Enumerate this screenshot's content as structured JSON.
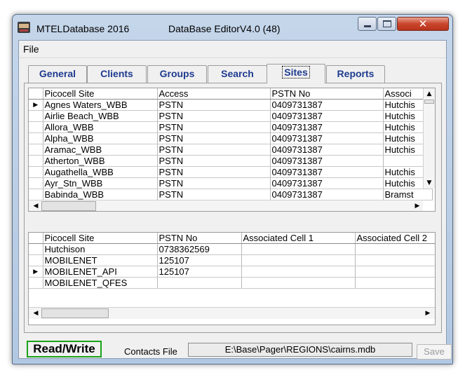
{
  "window": {
    "app_title": "MTELDatabase 2016",
    "editor_title": "DataBase EditorV4.0 (48)"
  },
  "menu": {
    "file": "File"
  },
  "tabs": [
    "General",
    "Clients",
    "Groups",
    "Search",
    "Sites",
    "Reports"
  ],
  "active_tab": "Sites",
  "sites_grid": {
    "columns": [
      "Picocell Site",
      "Access",
      "PSTN No",
      "Associ"
    ],
    "rows": [
      [
        "Agnes Waters_WBB",
        "PSTN",
        "0409731387",
        "Hutchis"
      ],
      [
        "Airlie Beach_WBB",
        "PSTN",
        "0409731387",
        "Hutchis"
      ],
      [
        "Allora_WBB",
        "PSTN",
        "0409731387",
        "Hutchis"
      ],
      [
        "Alpha_WBB",
        "PSTN",
        "0409731387",
        "Hutchis"
      ],
      [
        "Aramac_WBB",
        "PSTN",
        "0409731387",
        "Hutchis"
      ],
      [
        "Atherton_WBB",
        "PSTN",
        "0409731387",
        ""
      ],
      [
        "Augathella_WBB",
        "PSTN",
        "0409731387",
        "Hutchis"
      ],
      [
        "Ayr_Stn_WBB",
        "PSTN",
        "0409731387",
        "Hutchis"
      ],
      [
        "Babinda_WBB",
        "PSTN",
        "0409731387",
        "Bramst"
      ]
    ],
    "current_row": 0
  },
  "clients_grid": {
    "columns": [
      "Picocell Site",
      "PSTN No",
      "Associated Cell 1",
      "Associated Cell 2"
    ],
    "rows": [
      [
        "Hutchison",
        "0738362569",
        "",
        ""
      ],
      [
        "MOBILENET",
        "125107",
        "",
        ""
      ],
      [
        "MOBILENET_API",
        "125107",
        "",
        ""
      ],
      [
        "MOBILENET_QFES",
        "",
        "",
        ""
      ]
    ],
    "current_row": 2
  },
  "footer": {
    "mode": "Read/Write",
    "contacts_label": "Contacts File",
    "contacts_path": "E:\\Base\\Pager\\REGIONS\\cairns.mdb",
    "save_label": "Save"
  },
  "icons": {
    "app": "database-icon",
    "row_indicator": "triangle-right-icon",
    "minimize": "minimize-icon",
    "maximize": "maximize-icon",
    "close": "close-icon"
  }
}
